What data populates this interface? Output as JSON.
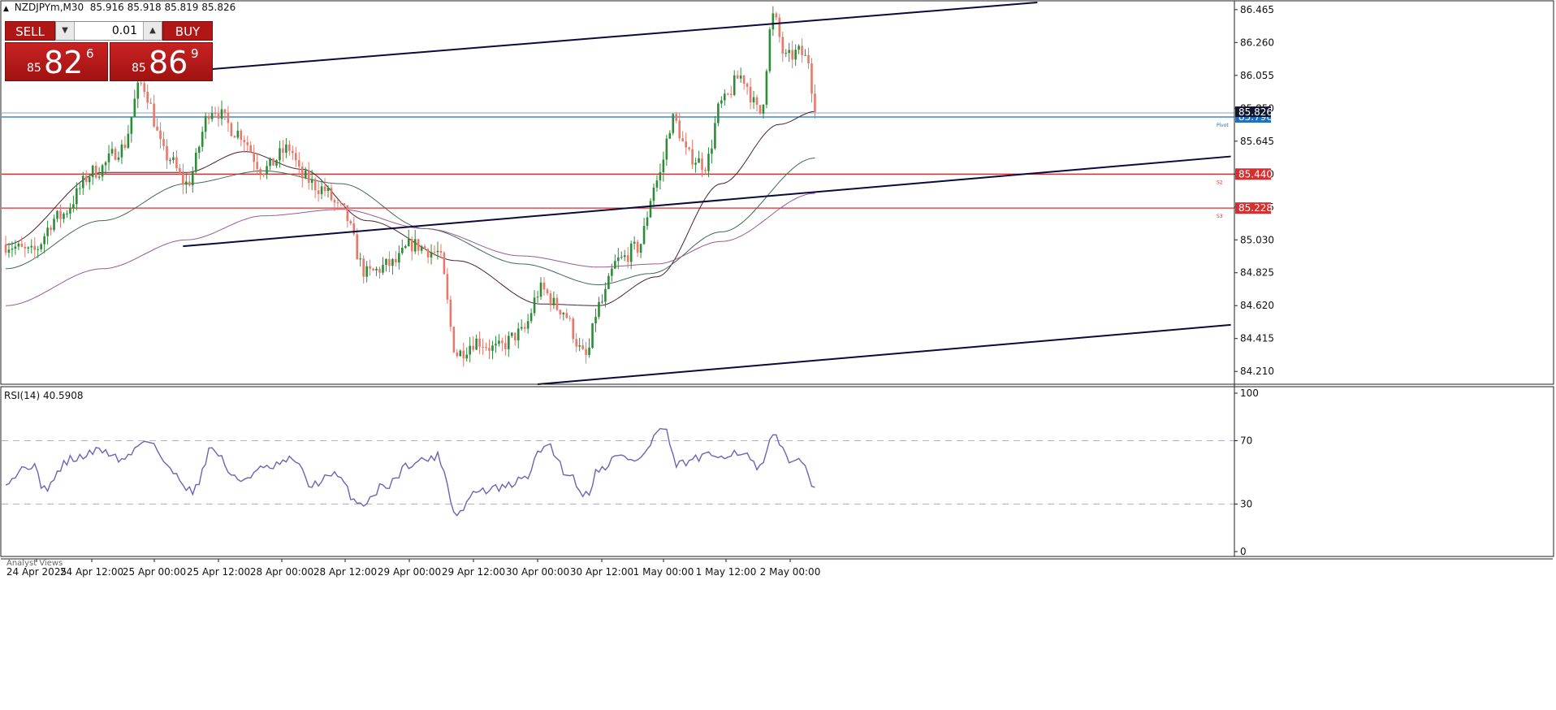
{
  "header": {
    "symbol": "NZDJPYm,M30",
    "open": "85.916",
    "high": "85.918",
    "low": "85.819",
    "close": "85.826"
  },
  "trade_panel": {
    "sell_label": "SELL",
    "buy_label": "BUY",
    "lot": "0.01",
    "sell_price": {
      "prefix": "85",
      "big": "82",
      "sup": "6"
    },
    "buy_price": {
      "prefix": "85",
      "big": "86",
      "sup": "9"
    }
  },
  "rsi_header": "RSI(14) 40.5908",
  "analyst_label": "Analyst Views",
  "colors": {
    "bull": "#2e8b3a",
    "bear": "#e8786a",
    "pivot_line": "#1f6fc4",
    "support_line": "#d62f2f",
    "channel": "#0a0a3c",
    "ma_fast": "#4a2030",
    "ma_mid": "#3d6b58",
    "ma_slow": "#9a5a94",
    "rsi": "#6b63b5",
    "trade_red": "#b01616"
  },
  "chart_data": [
    {
      "type": "candlestick",
      "symbol": "NZDJPYm",
      "timeframe": "M30",
      "ylim": [
        84.13,
        86.52
      ],
      "y_ticks": [
        "86.465",
        "86.260",
        "86.055",
        "85.850",
        "85.645",
        "85.440",
        "85.235",
        "85.030",
        "84.825",
        "84.620",
        "84.415",
        "84.210"
      ],
      "x_ticks": [
        "24 Apr 2025",
        "24 Apr 12:00",
        "25 Apr 00:00",
        "25 Apr 12:00",
        "28 Apr 00:00",
        "28 Apr 12:00",
        "29 Apr 00:00",
        "29 Apr 12:00",
        "30 Apr 00:00",
        "30 Apr 12:00",
        "1 May 00:00",
        "1 May 12:00",
        "2 May 00:00"
      ],
      "bars_shown": 200,
      "ohlc_anchor_points": [
        {
          "bar": 0,
          "price": 85.0
        },
        {
          "bar": 8,
          "price": 84.95
        },
        {
          "bar": 16,
          "price": 85.17
        },
        {
          "bar": 28,
          "price": 85.46
        },
        {
          "bar": 36,
          "price": 85.6
        },
        {
          "bar": 42,
          "price": 86.0
        },
        {
          "bar": 50,
          "price": 85.55
        },
        {
          "bar": 56,
          "price": 85.38
        },
        {
          "bar": 64,
          "price": 85.85
        },
        {
          "bar": 72,
          "price": 85.7
        },
        {
          "bar": 80,
          "price": 85.47
        },
        {
          "bar": 88,
          "price": 85.6
        },
        {
          "bar": 92,
          "price": 85.42
        },
        {
          "bar": 98,
          "price": 85.35
        },
        {
          "bar": 104,
          "price": 85.22
        },
        {
          "bar": 112,
          "price": 84.82
        },
        {
          "bar": 120,
          "price": 84.88
        },
        {
          "bar": 126,
          "price": 85.0
        },
        {
          "bar": 134,
          "price": 84.95
        },
        {
          "bar": 140,
          "price": 84.32
        },
        {
          "bar": 146,
          "price": 84.4
        },
        {
          "bar": 152,
          "price": 84.35
        },
        {
          "bar": 160,
          "price": 84.45
        },
        {
          "bar": 166,
          "price": 84.72
        },
        {
          "bar": 172,
          "price": 84.6
        },
        {
          "bar": 180,
          "price": 84.3
        },
        {
          "bar": 184,
          "price": 84.62
        },
        {
          "bar": 190,
          "price": 84.9
        },
        {
          "bar": 196,
          "price": 84.98
        },
        {
          "bar": 202,
          "price": 85.4
        },
        {
          "bar": 207,
          "price": 85.78
        },
        {
          "bar": 212,
          "price": 85.55
        },
        {
          "bar": 217,
          "price": 85.5
        },
        {
          "bar": 222,
          "price": 85.88
        },
        {
          "bar": 228,
          "price": 86.05
        },
        {
          "bar": 234,
          "price": 85.82
        },
        {
          "bar": 238,
          "price": 86.42
        },
        {
          "bar": 242,
          "price": 86.16
        },
        {
          "bar": 246,
          "price": 86.2
        },
        {
          "bar": 249,
          "price": 86.15
        },
        {
          "bar": 251,
          "price": 85.826
        }
      ],
      "moving_averages": [
        {
          "role": "fast",
          "anchors": [
            {
              "bar": 0,
              "price": 85.0
            },
            {
              "bar": 30,
              "price": 85.45
            },
            {
              "bar": 56,
              "price": 85.45
            },
            {
              "bar": 74,
              "price": 85.58
            },
            {
              "bar": 92,
              "price": 85.47
            },
            {
              "bar": 112,
              "price": 85.15
            },
            {
              "bar": 140,
              "price": 84.9
            },
            {
              "bar": 166,
              "price": 84.63
            },
            {
              "bar": 184,
              "price": 84.62
            },
            {
              "bar": 202,
              "price": 84.8
            },
            {
              "bar": 222,
              "price": 85.38
            },
            {
              "bar": 240,
              "price": 85.75
            },
            {
              "bar": 251,
              "price": 85.83
            }
          ]
        },
        {
          "role": "mid",
          "anchors": [
            {
              "bar": 0,
              "price": 84.85
            },
            {
              "bar": 30,
              "price": 85.15
            },
            {
              "bar": 56,
              "price": 85.38
            },
            {
              "bar": 80,
              "price": 85.46
            },
            {
              "bar": 104,
              "price": 85.38
            },
            {
              "bar": 130,
              "price": 85.1
            },
            {
              "bar": 160,
              "price": 84.88
            },
            {
              "bar": 184,
              "price": 84.75
            },
            {
              "bar": 200,
              "price": 84.82
            },
            {
              "bar": 222,
              "price": 85.08
            },
            {
              "bar": 251,
              "price": 85.54
            }
          ]
        },
        {
          "role": "slow",
          "anchors": [
            {
              "bar": 0,
              "price": 84.62
            },
            {
              "bar": 30,
              "price": 84.85
            },
            {
              "bar": 56,
              "price": 85.03
            },
            {
              "bar": 80,
              "price": 85.18
            },
            {
              "bar": 104,
              "price": 85.22
            },
            {
              "bar": 130,
              "price": 85.1
            },
            {
              "bar": 160,
              "price": 84.93
            },
            {
              "bar": 184,
              "price": 84.86
            },
            {
              "bar": 202,
              "price": 84.88
            },
            {
              "bar": 222,
              "price": 85.02
            },
            {
              "bar": 251,
              "price": 85.32
            }
          ]
        }
      ],
      "horizontal_levels": [
        {
          "price": 85.796,
          "label": "85.796",
          "tag": "Pivot",
          "role": "pivot"
        },
        {
          "price": 85.44,
          "label": "85.440",
          "tag": "S2",
          "role": "support"
        },
        {
          "price": 85.228,
          "label": "85.228",
          "tag": "S3",
          "role": "support"
        }
      ],
      "current_price_label": "85.826",
      "channel_lines": [
        {
          "start": {
            "bar": 55,
            "price": 86.08
          },
          "end": {
            "bar": 320,
            "price": 86.51
          }
        },
        {
          "start": {
            "bar": 55,
            "price": 84.99
          },
          "end": {
            "bar": 380,
            "price": 85.55
          }
        },
        {
          "start": {
            "bar": 165,
            "price": 84.13
          },
          "end": {
            "bar": 380,
            "price": 84.5
          }
        }
      ]
    },
    {
      "type": "line",
      "title": "RSI(14) 40.5908",
      "ylim": [
        0,
        100
      ],
      "y_ticks": [
        "100",
        "70",
        "30",
        "0"
      ],
      "levels": [
        70,
        30
      ],
      "anchor_points": [
        {
          "bar": 0,
          "price": 45
        },
        {
          "bar": 8,
          "price": 55
        },
        {
          "bar": 12,
          "price": 40
        },
        {
          "bar": 20,
          "price": 58
        },
        {
          "bar": 30,
          "price": 64
        },
        {
          "bar": 36,
          "price": 58
        },
        {
          "bar": 44,
          "price": 71
        },
        {
          "bar": 52,
          "price": 50
        },
        {
          "bar": 58,
          "price": 38
        },
        {
          "bar": 64,
          "price": 65
        },
        {
          "bar": 72,
          "price": 45
        },
        {
          "bar": 80,
          "price": 52
        },
        {
          "bar": 90,
          "price": 58
        },
        {
          "bar": 94,
          "price": 42
        },
        {
          "bar": 102,
          "price": 48
        },
        {
          "bar": 110,
          "price": 30
        },
        {
          "bar": 118,
          "price": 42
        },
        {
          "bar": 126,
          "price": 56
        },
        {
          "bar": 134,
          "price": 60
        },
        {
          "bar": 140,
          "price": 24
        },
        {
          "bar": 146,
          "price": 38
        },
        {
          "bar": 154,
          "price": 40
        },
        {
          "bar": 160,
          "price": 45
        },
        {
          "bar": 168,
          "price": 68
        },
        {
          "bar": 174,
          "price": 50
        },
        {
          "bar": 180,
          "price": 36
        },
        {
          "bar": 184,
          "price": 52
        },
        {
          "bar": 190,
          "price": 60
        },
        {
          "bar": 196,
          "price": 58
        },
        {
          "bar": 204,
          "price": 78
        },
        {
          "bar": 208,
          "price": 55
        },
        {
          "bar": 218,
          "price": 60
        },
        {
          "bar": 228,
          "price": 63
        },
        {
          "bar": 234,
          "price": 52
        },
        {
          "bar": 238,
          "price": 72
        },
        {
          "bar": 244,
          "price": 58
        },
        {
          "bar": 248,
          "price": 54
        },
        {
          "bar": 251,
          "price": 40.59
        }
      ]
    }
  ]
}
